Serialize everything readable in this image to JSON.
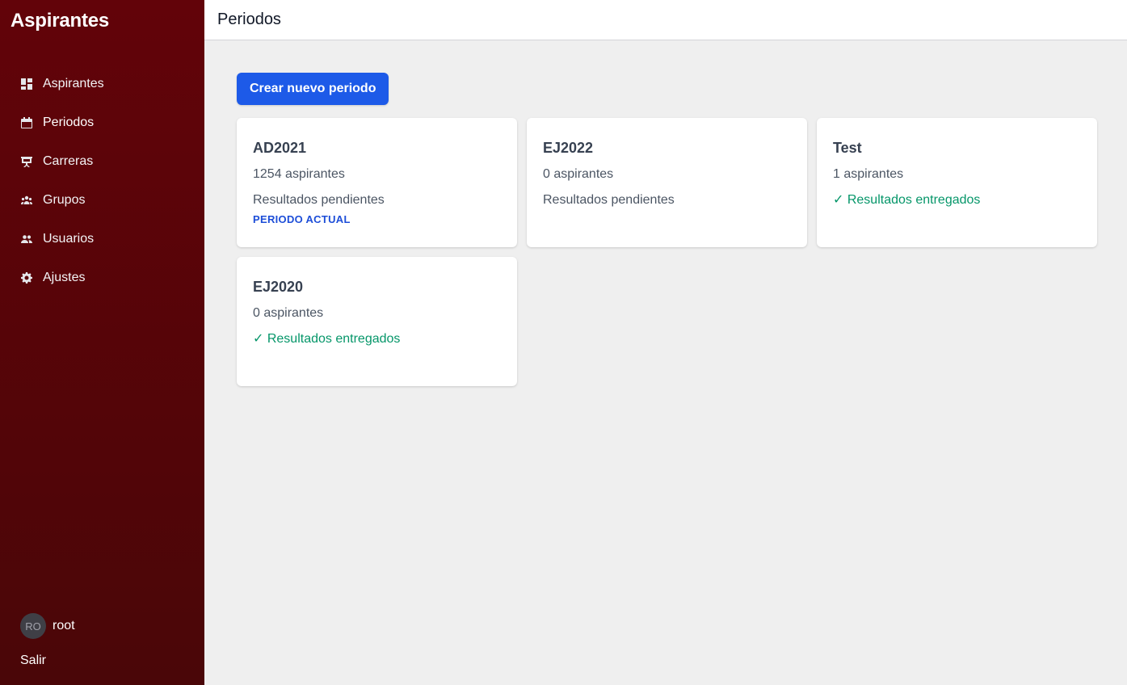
{
  "app": {
    "title": "Aspirantes"
  },
  "sidebar": {
    "items": [
      {
        "label": "Aspirantes",
        "icon": "dashboard-icon",
        "active": false
      },
      {
        "label": "Periodos",
        "icon": "calendar-icon",
        "active": true
      },
      {
        "label": "Carreras",
        "icon": "presentation-icon",
        "active": false
      },
      {
        "label": "Grupos",
        "icon": "group-icon",
        "active": false
      },
      {
        "label": "Usuarios",
        "icon": "users-icon",
        "active": false
      },
      {
        "label": "Ajustes",
        "icon": "gear-icon",
        "active": false
      }
    ],
    "user": {
      "initials": "RO",
      "name": "root"
    },
    "logout_label": "Salir"
  },
  "header": {
    "title": "Periodos"
  },
  "main": {
    "create_button": "Crear nuevo periodo",
    "periods": [
      {
        "name": "AD2021",
        "count": "1254 aspirantes",
        "status": "Resultados pendientes",
        "delivered": false,
        "badge": "PERIODO ACTUAL"
      },
      {
        "name": "EJ2022",
        "count": "0 aspirantes",
        "status": "Resultados pendientes",
        "delivered": false,
        "badge": ""
      },
      {
        "name": "Test",
        "count": "1 aspirantes",
        "status": "✓ Resultados entregados",
        "delivered": true,
        "badge": ""
      },
      {
        "name": "EJ2020",
        "count": "0 aspirantes",
        "status": "✓ Resultados entregados",
        "delivered": true,
        "badge": ""
      }
    ]
  },
  "colors": {
    "sidebar": "#620309",
    "primary_button": "#1d5ae8",
    "delivered": "#059669",
    "badge": "#1d4ed8"
  }
}
